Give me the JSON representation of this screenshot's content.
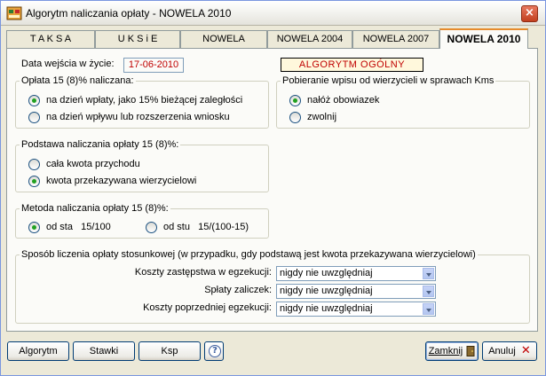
{
  "window": {
    "title": "Algorytm naliczania opłaty  - NOWELA 2010",
    "close_glyph": "×"
  },
  "tabs": [
    {
      "label": "T A K S A",
      "active": false
    },
    {
      "label": "U K S i E",
      "active": false
    },
    {
      "label": "NOWELA",
      "active": false
    },
    {
      "label": "NOWELA 2004",
      "active": false
    },
    {
      "label": "NOWELA 2007",
      "active": false
    },
    {
      "label": "NOWELA 2010",
      "active": true
    }
  ],
  "effective_date": {
    "label": "Data wejścia w życie:",
    "value": "17-06-2010"
  },
  "algorithm_badge": "ALGORYTM OGÓLNY",
  "fee_charged": {
    "title": "Opłata 15 (8)% naliczana:",
    "options": [
      {
        "label": "na dzień wpłaty, jako 15% bieżącej zaległości",
        "checked": true
      },
      {
        "label": "na dzień wpływu lub rozszerzenia wniosku",
        "checked": false
      }
    ]
  },
  "collection": {
    "title": "Pobieranie wpisu od wierzycieli w sprawach Kms",
    "options": [
      {
        "label": "nałóż obowiazek",
        "checked": true
      },
      {
        "label": "zwolnij",
        "checked": false
      }
    ]
  },
  "base": {
    "title": "Podstawa naliczania opłaty 15 (8)%:",
    "options": [
      {
        "label": "cała kwota przychodu",
        "checked": false
      },
      {
        "label": "kwota przekazywana wierzycielowi",
        "checked": true
      }
    ]
  },
  "method": {
    "title": "Metoda naliczania opłaty 15 (8)%:",
    "options": [
      {
        "label": "od sta   15/100",
        "checked": true
      },
      {
        "label": "od stu   15/(100-15)",
        "checked": false
      }
    ]
  },
  "relative": {
    "title": "Sposób liczenia opłaty stosunkowej (w przypadku, gdy podstawą jest kwota przekazywana wierzycielowi)",
    "rows": [
      {
        "label": "Koszty zastępstwa w egzekucji:",
        "value": "nigdy nie uwzględniaj"
      },
      {
        "label": "Spłaty zaliczek:",
        "value": "nigdy nie uwzględniaj"
      },
      {
        "label": "Koszty poprzedniej egzekucji:",
        "value": "nigdy nie uwzględniaj"
      }
    ]
  },
  "buttons": {
    "algorytm": "Algorytm",
    "stawki": "Stawki",
    "ksp": "Ksp",
    "help": "?",
    "zamknij": "Zamknij",
    "anuluj": "Anuluj",
    "anuluj_glyph": "✕"
  }
}
